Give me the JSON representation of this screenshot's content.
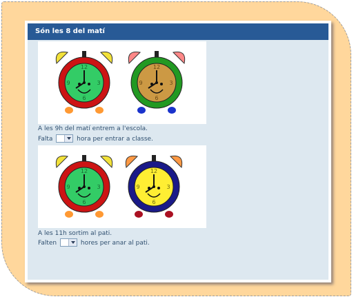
{
  "panel": {
    "title": "Són les 8 del matí"
  },
  "section1": {
    "statement": "A les 9h del matí entrem a l'escola.",
    "question_before": "Falta",
    "question_after": "hora per entrar a classe.",
    "answer_value": ""
  },
  "section2": {
    "statement": "A les 11h sortim al pati.",
    "question_before": "Falten",
    "question_after": "hores per anar al pati.",
    "answer_value": ""
  },
  "clocks": {
    "image1": [
      {
        "name": "red-clock",
        "rim": "#cc1414",
        "face": "#33cc66",
        "bells": "#f2e13a",
        "feet": "#ff9933",
        "numeral_color": "#1a6a33"
      },
      {
        "name": "green-clock",
        "rim": "#229922",
        "face": "#cc9944",
        "bells": "#ff8888",
        "feet": "#1a33cc",
        "numeral_color": "#6b4a16"
      }
    ],
    "image2": [
      {
        "name": "red-clock",
        "rim": "#cc1414",
        "face": "#33cc66",
        "bells": "#f2e13a",
        "feet": "#ff9933",
        "numeral_color": "#1a6a33"
      },
      {
        "name": "blue-clock",
        "rim": "#1a1a88",
        "face": "#ffee33",
        "bells": "#ff9944",
        "feet": "#aa1122",
        "numeral_color": "#6a6a10"
      }
    ]
  },
  "colors": {
    "header_bg": "#285a96",
    "panel_bg": "#dde8f0",
    "frame_bg": "#ffd79c",
    "text": "#2f4f6f"
  }
}
